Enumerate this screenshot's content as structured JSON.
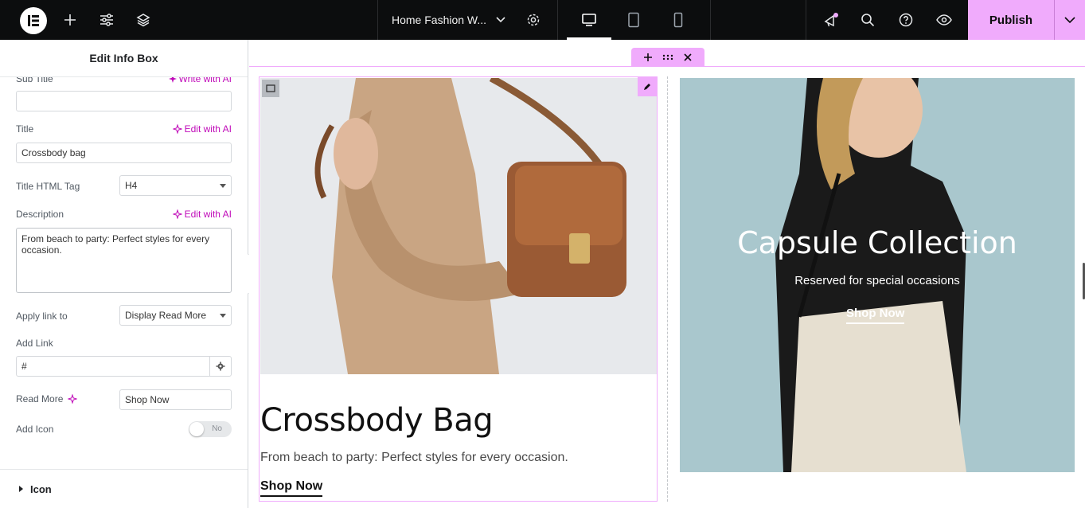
{
  "topbar": {
    "document_title": "Home Fashion W...",
    "publish_label": "Publish",
    "icons": [
      "elementor-logo-icon",
      "add-icon",
      "settings-sliders-icon",
      "layers-icon",
      "chevron-down-icon",
      "gear-icon",
      "desktop-icon",
      "tablet-icon",
      "mobile-icon",
      "whats-new-icon",
      "search-icon",
      "help-icon",
      "preview-eye-icon",
      "publish-chevron-icon"
    ]
  },
  "panel": {
    "title": "Edit Info Box",
    "sub_title_label": "Sub Title",
    "sub_title_value": "",
    "write_with_ai": "Write with AI",
    "edit_with_ai": "Edit with AI",
    "title_label": "Title",
    "title_value": "Crossbody bag",
    "title_tag_label": "Title HTML Tag",
    "title_tag_value": "H4",
    "description_label": "Description",
    "description_value": "From beach to party: Perfect styles for every occasion.",
    "apply_link_label": "Apply link to",
    "apply_link_value": "Display Read More",
    "add_link_label": "Add Link",
    "add_link_value": "#",
    "read_more_label": "Read More",
    "read_more_value": "Shop Now",
    "add_icon_label": "Add Icon",
    "add_icon_toggle": "No",
    "section_icon_label": "Icon"
  },
  "canvas": {
    "info_box": {
      "title": "Crossbody Bag",
      "description": "From beach to party: Perfect styles for every occasion.",
      "link": "Shop Now"
    },
    "banner": {
      "title": "Capsule Collection",
      "subtitle": "Reserved for special occasions",
      "link": "Shop Now"
    }
  },
  "colors": {
    "accent": "#f0abfc",
    "ai_magenta": "#c00bb9",
    "topbar_bg": "#0c0d0e",
    "banner_bg": "#a9c7cd"
  }
}
